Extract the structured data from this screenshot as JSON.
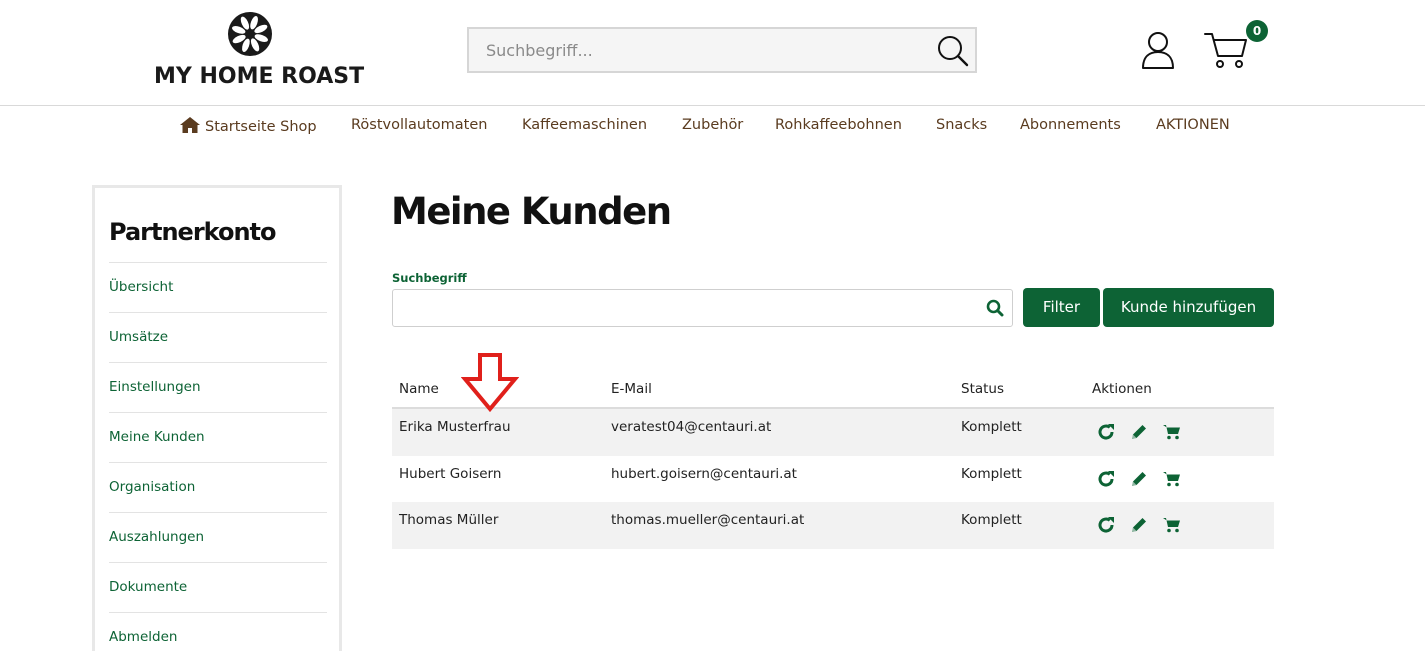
{
  "header": {
    "logo_text": "MY HOME ROAST",
    "search_placeholder": "Suchbegriff...",
    "cart_count": "0"
  },
  "nav": {
    "items": [
      "Startseite Shop",
      "Röstvollautomaten",
      "Kaffeemaschinen",
      "Zubehör",
      "Rohkaffeebohnen",
      "Snacks",
      "Abonnements",
      "AKTIONEN"
    ]
  },
  "sidebar": {
    "title": "Partnerkonto",
    "items": [
      "Übersicht",
      "Umsätze",
      "Einstellungen",
      "Meine Kunden",
      "Organisation",
      "Auszahlungen",
      "Dokumente",
      "Abmelden"
    ]
  },
  "main": {
    "title": "Meine Kunden",
    "search_label": "Suchbegriff",
    "search_value": "",
    "filter_button": "Filter",
    "add_button": "Kunde hinzufügen",
    "table": {
      "headers": [
        "Name",
        "E-Mail",
        "Status",
        "Aktionen"
      ],
      "rows": [
        {
          "name": "Erika Musterfrau",
          "email": "veratest04@centauri.at",
          "status": "Komplett"
        },
        {
          "name": "Hubert Goisern",
          "email": "hubert.goisern@centauri.at",
          "status": "Komplett"
        },
        {
          "name": "Thomas Müller",
          "email": "thomas.mueller@centauri.at",
          "status": "Komplett"
        }
      ]
    }
  },
  "colors": {
    "brand_green": "#0d6335",
    "nav_brown": "#5a3b1f",
    "annotation_red": "#e0201b"
  },
  "icons": {
    "search": "search-icon",
    "user": "user-icon",
    "cart": "cart-icon",
    "home": "home-icon",
    "refresh": "refresh-icon",
    "edit": "pencil-icon",
    "order": "cart-icon",
    "annotation": "arrow-down-icon"
  }
}
